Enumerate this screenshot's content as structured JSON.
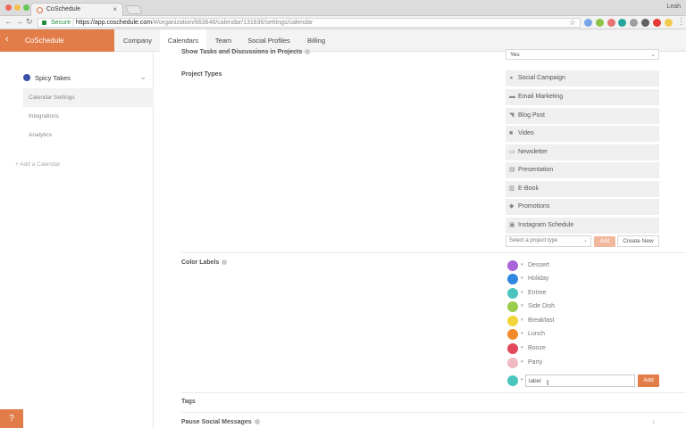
{
  "browser": {
    "tab_title": "CoSchedule",
    "tab_close": "×",
    "user_name": "Leah",
    "url_secure": "Secure",
    "url_sep": " | ",
    "url_host": "https://app.coschedule.com",
    "url_path": "/#/organization/663646/calendar/131836/settings/calendar",
    "star": "☆",
    "nav": {
      "back": "←",
      "forward": "→",
      "reload": "↻"
    }
  },
  "app": {
    "brand": "CoSchedule",
    "back_icon": "‹",
    "nav_tabs": [
      "Company",
      "Calendars",
      "Team",
      "Social Profiles",
      "Billing"
    ]
  },
  "sidebar": {
    "calendar_name": "Spicy Takes",
    "calendar_color": "#3a4fa6",
    "chevron": "⌄",
    "items": [
      "Calendar Settings",
      "Integrations",
      "Analytics"
    ],
    "add_calendar": "+  Add a Calendar"
  },
  "main": {
    "show_tasks_label": "Show Tasks and Discussions in Projects",
    "show_tasks_value": "Yes",
    "select_arrow": "⌄",
    "project_types_label": "Project Types",
    "project_types": [
      {
        "icon": "◂",
        "label": "Social Campaign"
      },
      {
        "icon": "▬",
        "label": "Email Marketing"
      },
      {
        "icon": "◥",
        "label": "Blog Post"
      },
      {
        "icon": "■",
        "label": "Video"
      },
      {
        "icon": "▭",
        "label": "Newsletter"
      },
      {
        "icon": "▤",
        "label": "Presentation"
      },
      {
        "icon": "▥",
        "label": "E-Book"
      },
      {
        "icon": "◆",
        "label": "Promotions"
      },
      {
        "icon": "▣",
        "label": "Instagram Schedule"
      }
    ],
    "project_type_placeholder": "Select a project type",
    "add_label": "Add",
    "create_new_label": "Create New",
    "color_labels_label": "Color Labels",
    "color_labels": [
      {
        "name": "Dessert",
        "color": "#a964d9"
      },
      {
        "name": "Holiday",
        "color": "#2f87e2"
      },
      {
        "name": "Entree",
        "color": "#4bc4be"
      },
      {
        "name": "Side Dish",
        "color": "#9ccc4b"
      },
      {
        "name": "Breakfast",
        "color": "#f3d53a"
      },
      {
        "name": "Lunch",
        "color": "#f28b2a"
      },
      {
        "name": "Booze",
        "color": "#e2485a"
      },
      {
        "name": "Party",
        "color": "#f0b9c2"
      }
    ],
    "new_label_color": "#4bc4be",
    "new_label_value": "label",
    "new_label_add": "Add",
    "chev_small": "▾",
    "tags_label": "Tags",
    "pause_social_label": "Pause Social Messages",
    "right_chevron": "›"
  },
  "help_label": "?",
  "colors": {
    "accent": "#e27d4a"
  }
}
